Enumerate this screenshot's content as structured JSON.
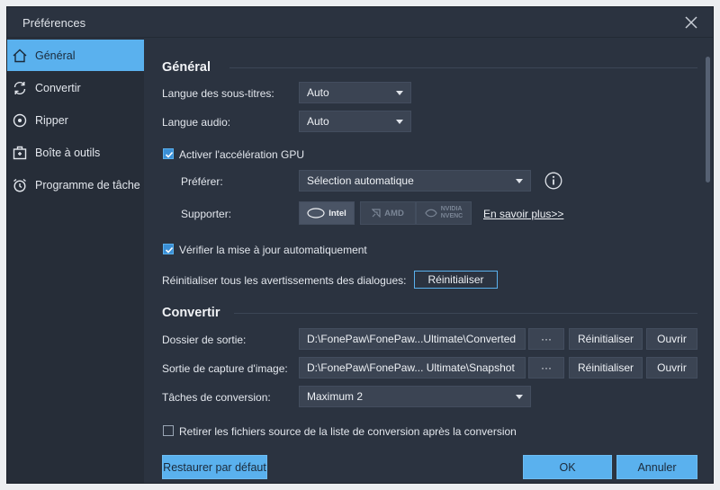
{
  "window": {
    "title": "Préférences"
  },
  "sidebar": {
    "items": [
      {
        "label": "Général",
        "icon": "home-icon",
        "active": true
      },
      {
        "label": "Convertir",
        "icon": "convert-icon",
        "active": false
      },
      {
        "label": "Ripper",
        "icon": "disc-icon",
        "active": false
      },
      {
        "label": "Boîte à outils",
        "icon": "toolbox-icon",
        "active": false
      },
      {
        "label": "Programme de tâche",
        "icon": "alarm-clock-icon",
        "active": false
      }
    ]
  },
  "general": {
    "title": "Général",
    "subtitle_language_label": "Langue des sous-titres:",
    "subtitle_language_value": "Auto",
    "audio_language_label": "Langue audio:",
    "audio_language_value": "Auto",
    "gpu_accel_label": "Activer l'accélération GPU",
    "gpu_accel_checked": true,
    "prefer_label": "Préférer:",
    "prefer_value": "Sélection automatique",
    "support_label": "Supporter:",
    "gpu_vendors": [
      {
        "label": "Intel",
        "active": true
      },
      {
        "label": "AMD",
        "active": false
      },
      {
        "label": "NVIDIA NVENC",
        "line1": "NVIDIA",
        "line2": "NVENC",
        "active": false
      }
    ],
    "learn_more": "En savoir plus>>",
    "auto_update_label": "Vérifier la mise à jour automatiquement",
    "auto_update_checked": true,
    "reset_warnings_label": "Réinitialiser tous les avertissements des dialogues:",
    "reset_warnings_button": "Réinitialiser"
  },
  "convert": {
    "title": "Convertir",
    "output_folder_label": "Dossier de sortie:",
    "output_folder_value": "D:\\FonePaw\\FonePaw...Ultimate\\Converted",
    "snapshot_label": "Sortie de capture d'image:",
    "snapshot_value": "D:\\FonePaw\\FonePaw... Ultimate\\Snapshot",
    "browse_label": "···",
    "reset_label": "Réinitialiser",
    "open_label": "Ouvrir",
    "tasks_label": "Tâches de conversion:",
    "tasks_value": "Maximum 2",
    "remove_source_label": "Retirer les fichiers source de la liste de conversion après la conversion",
    "remove_source_checked": false
  },
  "footer": {
    "restore_defaults": "Restaurer par défaut",
    "ok": "OK",
    "cancel": "Annuler"
  },
  "colors": {
    "accent": "#5ab1ee",
    "background": "#2b3340",
    "sidebar": "#262d38"
  }
}
